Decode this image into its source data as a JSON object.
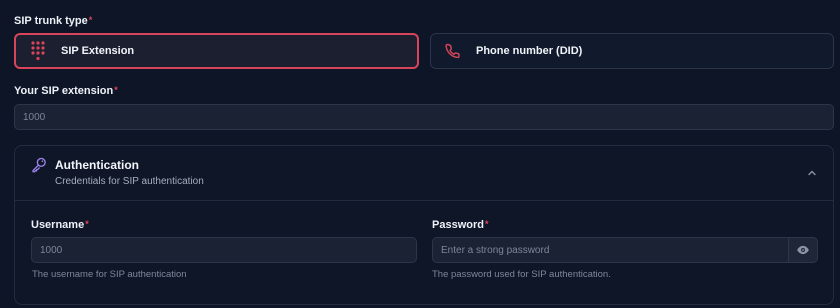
{
  "trunk_type": {
    "label": "SIP trunk type",
    "required_mark": "*",
    "options": [
      {
        "label": "SIP Extension",
        "icon": "dialpad-icon",
        "selected": true
      },
      {
        "label": "Phone number (DID)",
        "icon": "phone-icon",
        "selected": false
      }
    ]
  },
  "extension": {
    "label": "Your SIP extension",
    "required_mark": "*",
    "placeholder": "1000"
  },
  "auth": {
    "title": "Authentication",
    "subtitle": "Credentials for SIP authentication",
    "icon": "key-icon",
    "expanded": true,
    "username": {
      "label": "Username",
      "required_mark": "*",
      "placeholder": "1000",
      "help": "The username for SIP authentication"
    },
    "password": {
      "label": "Password",
      "required_mark": "*",
      "placeholder": "Enter a strong password",
      "help": "The password used for SIP authentication.",
      "toggle_icon": "eye-icon"
    }
  },
  "colors": {
    "background": "#0d1526",
    "accent_red": "#d8455a",
    "key_icon": "#9b82e8"
  }
}
